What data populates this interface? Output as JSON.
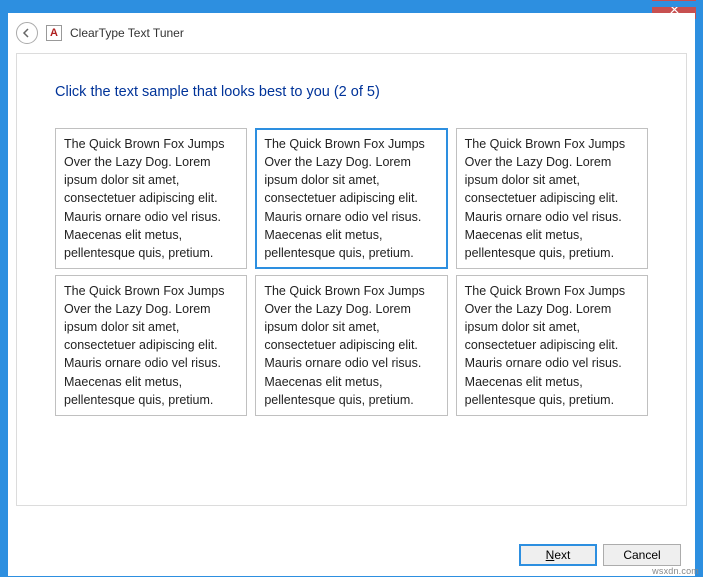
{
  "window": {
    "title": "ClearType Text Tuner",
    "icon_glyph": "A"
  },
  "instruction": "Click the text sample that looks best to you (2 of 5)",
  "sample_text": "The Quick Brown Fox Jumps Over the Lazy Dog. Lorem ipsum dolor sit amet, consectetuer adipiscing elit. Mauris ornare odio vel risus. Maecenas elit metus, pellentesque quis, pretium.",
  "samples": [
    {
      "selected": false
    },
    {
      "selected": true
    },
    {
      "selected": false
    },
    {
      "selected": false
    },
    {
      "selected": false
    },
    {
      "selected": false
    }
  ],
  "buttons": {
    "next": "Next",
    "cancel": "Cancel"
  },
  "watermark": "wsxdn.com"
}
